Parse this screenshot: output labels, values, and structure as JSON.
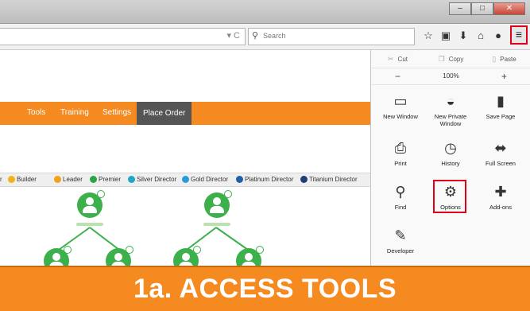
{
  "browser": {
    "window_controls": {
      "minimize": "–",
      "maximize": "□",
      "close": "✕"
    },
    "url_icons": "▾ C",
    "search_placeholder": "Search",
    "toolbar_icons": [
      "star-icon",
      "clipboard-icon",
      "download-icon",
      "home-icon",
      "chat-icon"
    ],
    "menu_button_icon": "≡"
  },
  "site_nav": {
    "items": [
      "Tools",
      "Training",
      "Settings"
    ],
    "active_item": "Place Order"
  },
  "legend": {
    "leading": "r",
    "items": [
      {
        "label": "Builder",
        "color": "#f2b21b"
      },
      {
        "label": "Leader",
        "color": "#f2a11b"
      },
      {
        "label": "Premier",
        "color": "#2aa54a"
      },
      {
        "label": "Silver Director",
        "color": "#1fa7c9"
      },
      {
        "label": "Gold Director",
        "color": "#2a9bd6"
      },
      {
        "label": "Platinum Director",
        "color": "#1e5fa8"
      },
      {
        "label": "Titanium Director",
        "color": "#1c3f7a"
      }
    ]
  },
  "firefox_menu": {
    "edit_row": {
      "cut": "Cut",
      "copy": "Copy",
      "paste": "Paste"
    },
    "zoom_row": {
      "minus": "−",
      "zoom_level": "100%",
      "plus": "+"
    },
    "items": [
      {
        "label": "New Window",
        "glyph": "▭"
      },
      {
        "label": "New Private Window",
        "glyph": "◒"
      },
      {
        "label": "Save Page",
        "glyph": "▮"
      },
      {
        "label": "Print",
        "glyph": "⎙"
      },
      {
        "label": "History",
        "glyph": "◷"
      },
      {
        "label": "Full Screen",
        "glyph": "⬌"
      },
      {
        "label": "Find",
        "glyph": "⚲"
      },
      {
        "label": "Options",
        "glyph": "⚙"
      },
      {
        "label": "Add-ons",
        "glyph": "✚"
      },
      {
        "label": "Developer",
        "glyph": "✎"
      }
    ]
  },
  "banner": {
    "title": "1a. ACCESS TOOLS"
  },
  "colors": {
    "accent_orange": "#f48a20",
    "highlight_red": "#e0001a",
    "node_green": "#3cb04a"
  }
}
